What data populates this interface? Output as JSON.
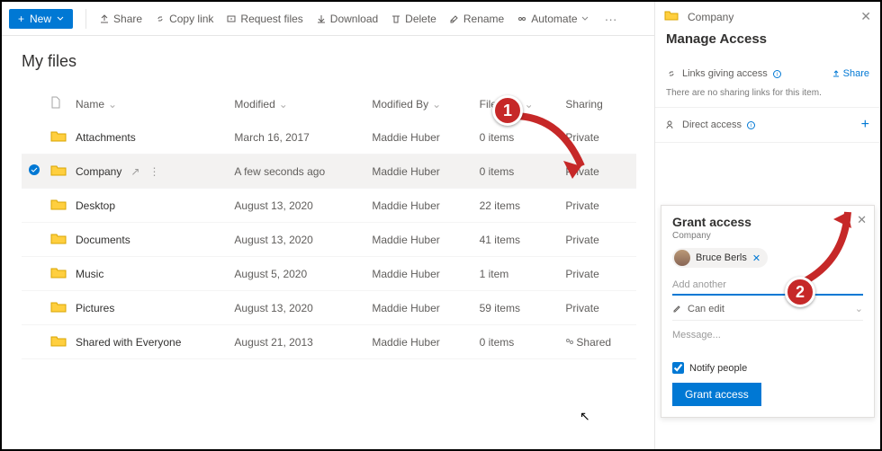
{
  "toolbar": {
    "new": "New",
    "share": "Share",
    "copy_link": "Copy link",
    "request_files": "Request files",
    "download": "Download",
    "delete": "Delete",
    "rename": "Rename",
    "automate": "Automate"
  },
  "page": {
    "title": "My files"
  },
  "columns": {
    "name": "Name",
    "modified": "Modified",
    "modified_by": "Modified By",
    "file_size": "File Size",
    "sharing": "Sharing"
  },
  "rows": [
    {
      "name": "Attachments",
      "modified": "March 16, 2017",
      "by": "Maddie Huber",
      "size": "0 items",
      "sharing": "Private"
    },
    {
      "name": "Company",
      "modified": "A few seconds ago",
      "by": "Maddie Huber",
      "size": "0 items",
      "sharing": "Private",
      "selected": true
    },
    {
      "name": "Desktop",
      "modified": "August 13, 2020",
      "by": "Maddie Huber",
      "size": "22 items",
      "sharing": "Private"
    },
    {
      "name": "Documents",
      "modified": "August 13, 2020",
      "by": "Maddie Huber",
      "size": "41 items",
      "sharing": "Private"
    },
    {
      "name": "Music",
      "modified": "August 5, 2020",
      "by": "Maddie Huber",
      "size": "1 item",
      "sharing": "Private"
    },
    {
      "name": "Pictures",
      "modified": "August 13, 2020",
      "by": "Maddie Huber",
      "size": "59 items",
      "sharing": "Private"
    },
    {
      "name": "Shared with Everyone",
      "modified": "August 21, 2013",
      "by": "Maddie Huber",
      "size": "0 items",
      "sharing": "Shared"
    }
  ],
  "panel": {
    "folder": "Company",
    "title": "Manage Access",
    "links_label": "Links giving access",
    "share_link": "Share",
    "no_links": "There are no sharing links for this item.",
    "direct_label": "Direct access"
  },
  "grant": {
    "title": "Grant access",
    "subtitle": "Company",
    "chip_name": "Bruce Berls",
    "add_placeholder": "Add another",
    "permission": "Can edit",
    "message_placeholder": "Message...",
    "notify_label": "Notify people",
    "button": "Grant access"
  },
  "callouts": {
    "one": "1",
    "two": "2"
  }
}
